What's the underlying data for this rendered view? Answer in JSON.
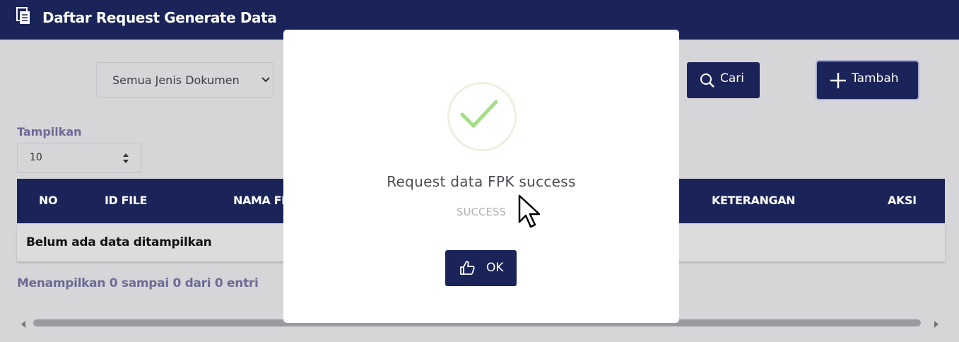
{
  "header": {
    "title": "Daftar Request Generate Data",
    "icon": "document-icon"
  },
  "filters": {
    "doc_type_selected": "Semua Jenis Dokumen",
    "search_label": "Cari",
    "add_label": "Tambah"
  },
  "length": {
    "label": "Tampilkan",
    "value": "10"
  },
  "table": {
    "columns": [
      "NO",
      "ID FILE",
      "NAMA FI",
      "KETERANGAN",
      "AKSI"
    ],
    "empty_message": "Belum ada data ditampilkan"
  },
  "info": "Menampilkan 0 sampai 0 dari 0 entri",
  "modal": {
    "title": "Request data FPK success",
    "text": "SUCCESS",
    "ok_label": "OK",
    "success_color": "#a5dc86"
  },
  "colors": {
    "primary": "#1b2459",
    "muted_text": "#6d6b94"
  }
}
